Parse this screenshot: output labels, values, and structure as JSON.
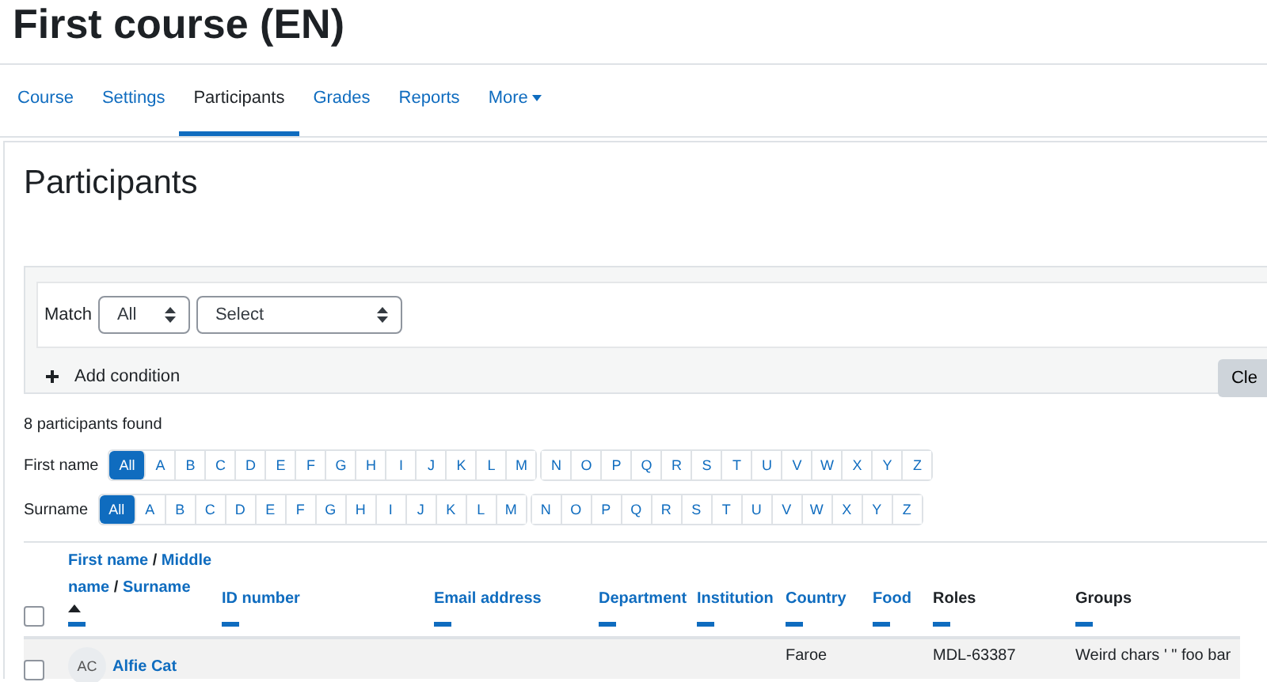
{
  "course_title": "First course (EN)",
  "tabs": [
    {
      "label": "Course",
      "selected": false
    },
    {
      "label": "Settings",
      "selected": false
    },
    {
      "label": "Participants",
      "selected": true
    },
    {
      "label": "Grades",
      "selected": false
    },
    {
      "label": "Reports",
      "selected": false
    },
    {
      "label": "More",
      "selected": false,
      "kind": "dropdown"
    }
  ],
  "page_heading": "Participants",
  "filter": {
    "match_label": "Match",
    "match_value": "All",
    "condition_value": "Select",
    "add_condition": "Add condition",
    "clear_button": "Cle"
  },
  "count": "8 participants found",
  "initials_bars": [
    {
      "label": "First name",
      "letters": [
        {
          "label": "All",
          "selected": true
        },
        {
          "label": "A",
          "selected": false
        },
        {
          "label": "B",
          "selected": false
        },
        {
          "label": "C",
          "selected": false
        },
        {
          "label": "D",
          "selected": false
        },
        {
          "label": "E",
          "selected": false
        },
        {
          "label": "F",
          "selected": false
        },
        {
          "label": "G",
          "selected": false
        },
        {
          "label": "H",
          "selected": false
        },
        {
          "label": "I",
          "selected": false
        },
        {
          "label": "J",
          "selected": false
        },
        {
          "label": "K",
          "selected": false
        },
        {
          "label": "L",
          "selected": false
        },
        {
          "label": "M",
          "selected": false
        }
      ],
      "letters_2": [
        {
          "label": "N",
          "selected": false
        },
        {
          "label": "O",
          "selected": false
        },
        {
          "label": "P",
          "selected": false
        },
        {
          "label": "Q",
          "selected": false
        },
        {
          "label": "R",
          "selected": false
        },
        {
          "label": "S",
          "selected": false
        },
        {
          "label": "T",
          "selected": false
        },
        {
          "label": "U",
          "selected": false
        },
        {
          "label": "V",
          "selected": false
        },
        {
          "label": "W",
          "selected": false
        },
        {
          "label": "X",
          "selected": false
        },
        {
          "label": "Y",
          "selected": false
        },
        {
          "label": "Z",
          "selected": false
        }
      ]
    },
    {
      "label": "Surname",
      "letters": [
        {
          "label": "All",
          "selected": true
        },
        {
          "label": "A",
          "selected": false
        },
        {
          "label": "B",
          "selected": false
        },
        {
          "label": "C",
          "selected": false
        },
        {
          "label": "D",
          "selected": false
        },
        {
          "label": "E",
          "selected": false
        },
        {
          "label": "F",
          "selected": false
        },
        {
          "label": "G",
          "selected": false
        },
        {
          "label": "H",
          "selected": false
        },
        {
          "label": "I",
          "selected": false
        },
        {
          "label": "J",
          "selected": false
        },
        {
          "label": "K",
          "selected": false
        },
        {
          "label": "L",
          "selected": false
        },
        {
          "label": "M",
          "selected": false
        }
      ],
      "letters_2": [
        {
          "label": "N",
          "selected": false
        },
        {
          "label": "O",
          "selected": false
        },
        {
          "label": "P",
          "selected": false
        },
        {
          "label": "Q",
          "selected": false
        },
        {
          "label": "R",
          "selected": false
        },
        {
          "label": "S",
          "selected": false
        },
        {
          "label": "T",
          "selected": false
        },
        {
          "label": "U",
          "selected": false
        },
        {
          "label": "V",
          "selected": false
        },
        {
          "label": "W",
          "selected": false
        },
        {
          "label": "X",
          "selected": false
        },
        {
          "label": "Y",
          "selected": false
        },
        {
          "label": "Z",
          "selected": false
        }
      ]
    }
  ],
  "table": {
    "select_all_checked": false,
    "label_separator": "/",
    "columns": [
      {
        "label_parts": [
          "First name",
          "Middle name",
          "Surname"
        ],
        "sortable": true,
        "sorted": true
      },
      {
        "label_parts": [
          "ID number"
        ],
        "sortable": true,
        "sorted": false
      },
      {
        "label_parts": [
          "Email address"
        ],
        "sortable": true,
        "sorted": false
      },
      {
        "label_parts": [
          "Department"
        ],
        "sortable": true,
        "sorted": false
      },
      {
        "label_parts": [
          "Institution"
        ],
        "sortable": true,
        "sorted": false
      },
      {
        "label_parts": [
          "Country"
        ],
        "sortable": true,
        "sorted": false
      },
      {
        "label_parts": [
          "Food"
        ],
        "sortable": true,
        "sorted": false
      },
      {
        "label_parts": [
          "Roles"
        ],
        "sortable": false,
        "sorted": false
      },
      {
        "label_parts": [
          "Groups"
        ],
        "sortable": false,
        "sorted": false
      }
    ],
    "rows": [
      {
        "checked": false,
        "initials": "AC",
        "name": "Alfie Cat",
        "country": "Faroe",
        "roles": "MDL-63387",
        "groups": "Weird chars ' \" foo bar"
      }
    ]
  }
}
